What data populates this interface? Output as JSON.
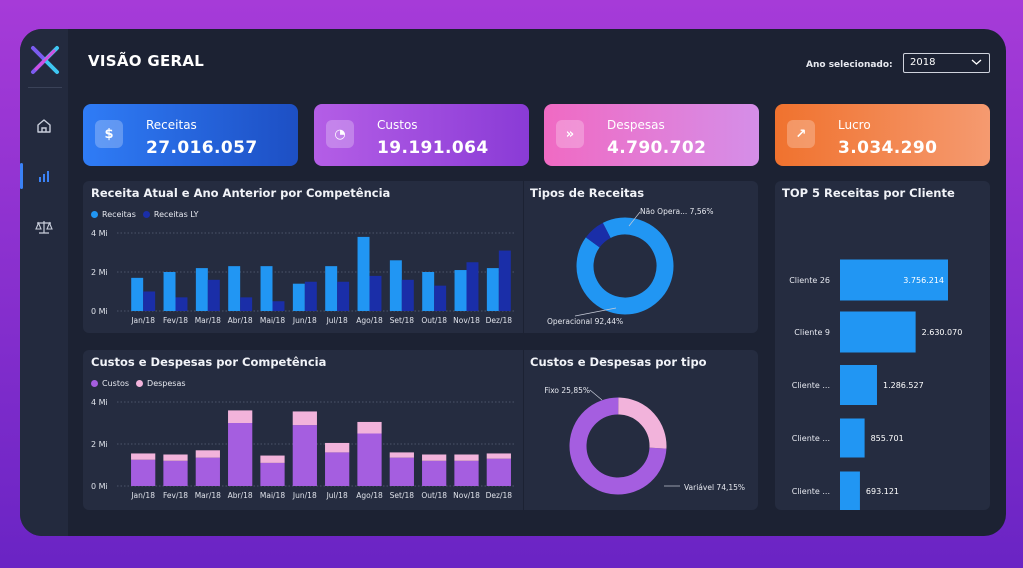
{
  "header": {
    "title": "VISÃO GERAL",
    "year_label": "Ano selecionado:",
    "year_value": "2018"
  },
  "sidebar": {
    "items": [
      {
        "name": "home",
        "icon": "home-icon"
      },
      {
        "name": "charts",
        "icon": "bar-chart-icon",
        "active": true
      },
      {
        "name": "balance",
        "icon": "balance-scale-icon"
      }
    ]
  },
  "kpis": [
    {
      "label": "Receitas",
      "value": "27.016.057",
      "icon": "dollar-icon",
      "glyph": "$",
      "gradient": [
        "#2f7cf6",
        "#1d4fc4"
      ]
    },
    {
      "label": "Custos",
      "value": "19.191.064",
      "icon": "pie-icon",
      "glyph": "◔",
      "gradient": [
        "#b45ee6",
        "#8a3bd6"
      ]
    },
    {
      "label": "Despesas",
      "value": "4.790.702",
      "icon": "chevrons-down-icon",
      "glyph": "»",
      "gradient": [
        "#f06ac3",
        "#d58ee8"
      ]
    },
    {
      "label": "Lucro",
      "value": "3.034.290",
      "icon": "trend-up-icon",
      "glyph": "↗",
      "gradient": [
        "#f0722e",
        "#f59a70"
      ]
    }
  ],
  "panels": {
    "receita": {
      "title": "Receita Atual e Ano Anterior por Competência",
      "legend": [
        {
          "label": "Receitas",
          "color": "#2196f3"
        },
        {
          "label": "Receitas LY",
          "color": "#1a2ea8"
        }
      ]
    },
    "tipos_receitas": {
      "title": "Tipos de Receitas"
    },
    "custos": {
      "title": "Custos e Despesas por Competência",
      "legend": [
        {
          "label": "Custos",
          "color": "#a55ee0"
        },
        {
          "label": "Despesas",
          "color": "#f2b3db"
        }
      ]
    },
    "custos_tipo": {
      "title": "Custos e Despesas por tipo"
    },
    "top5": {
      "title": "TOP 5 Receitas por Cliente"
    }
  },
  "chart_data": [
    {
      "type": "bar",
      "title": "Receita Atual e Ano Anterior por Competência",
      "categories": [
        "Jan/18",
        "Fev/18",
        "Mar/18",
        "Abr/18",
        "Mai/18",
        "Jun/18",
        "Jul/18",
        "Ago/18",
        "Set/18",
        "Out/18",
        "Nov/18",
        "Dez/18"
      ],
      "series": [
        {
          "name": "Receitas",
          "color": "#2196f3",
          "values": [
            1.7,
            2.0,
            2.2,
            2.3,
            2.3,
            1.4,
            2.3,
            3.8,
            2.6,
            2.0,
            2.1,
            2.2
          ]
        },
        {
          "name": "Receitas LY",
          "color": "#1a2ea8",
          "values": [
            1.0,
            0.7,
            1.6,
            0.7,
            0.5,
            1.5,
            1.5,
            1.8,
            1.6,
            1.3,
            2.5,
            3.1
          ]
        }
      ],
      "yticks": [
        "0 Mi",
        "2 Mi",
        "4 Mi"
      ],
      "ylim": [
        0,
        4
      ]
    },
    {
      "type": "pie",
      "title": "Tipos de Receitas",
      "slices": [
        {
          "label": "Operacional",
          "value": 92.44,
          "text": "Operacional 92,44%",
          "color": "#2196f3"
        },
        {
          "label": "Não Opera...",
          "value": 7.56,
          "text": "Não Opera... 7,56%",
          "color": "#1a2ea8"
        }
      ]
    },
    {
      "type": "bar",
      "title": "Custos e Despesas por Competência",
      "stacked": true,
      "categories": [
        "Jan/18",
        "Fev/18",
        "Mar/18",
        "Abr/18",
        "Mai/18",
        "Jun/18",
        "Jul/18",
        "Ago/18",
        "Set/18",
        "Out/18",
        "Nov/18",
        "Dez/18"
      ],
      "series": [
        {
          "name": "Custos",
          "color": "#a55ee0",
          "values": [
            1.25,
            1.2,
            1.35,
            3.0,
            1.1,
            2.9,
            1.6,
            2.5,
            1.35,
            1.2,
            1.2,
            1.3
          ]
        },
        {
          "name": "Despesas",
          "color": "#f2b3db",
          "values": [
            0.3,
            0.3,
            0.35,
            0.6,
            0.35,
            0.65,
            0.45,
            0.55,
            0.25,
            0.3,
            0.3,
            0.25
          ]
        }
      ],
      "yticks": [
        "0 Mi",
        "2 Mi",
        "4 Mi"
      ],
      "ylim": [
        0,
        4
      ]
    },
    {
      "type": "pie",
      "title": "Custos e Despesas por tipo",
      "slices": [
        {
          "label": "Variável",
          "value": 74.15,
          "text": "Variável 74,15%",
          "color": "#a55ee0"
        },
        {
          "label": "Fixo",
          "value": 25.85,
          "text": "Fixo 25,85%",
          "color": "#f2b3db"
        }
      ]
    },
    {
      "type": "bar",
      "orientation": "horizontal",
      "title": "TOP 5 Receitas por Cliente",
      "categories": [
        "Cliente 26",
        "Cliente 9",
        "Cliente ...",
        "Cliente ...",
        "Cliente ..."
      ],
      "values": [
        3756214,
        2630070,
        1286527,
        855701,
        693121
      ],
      "labels": [
        "3.756.214",
        "2.630.070",
        "1.286.527",
        "855.701",
        "693.121"
      ],
      "color": "#2196f3"
    }
  ]
}
